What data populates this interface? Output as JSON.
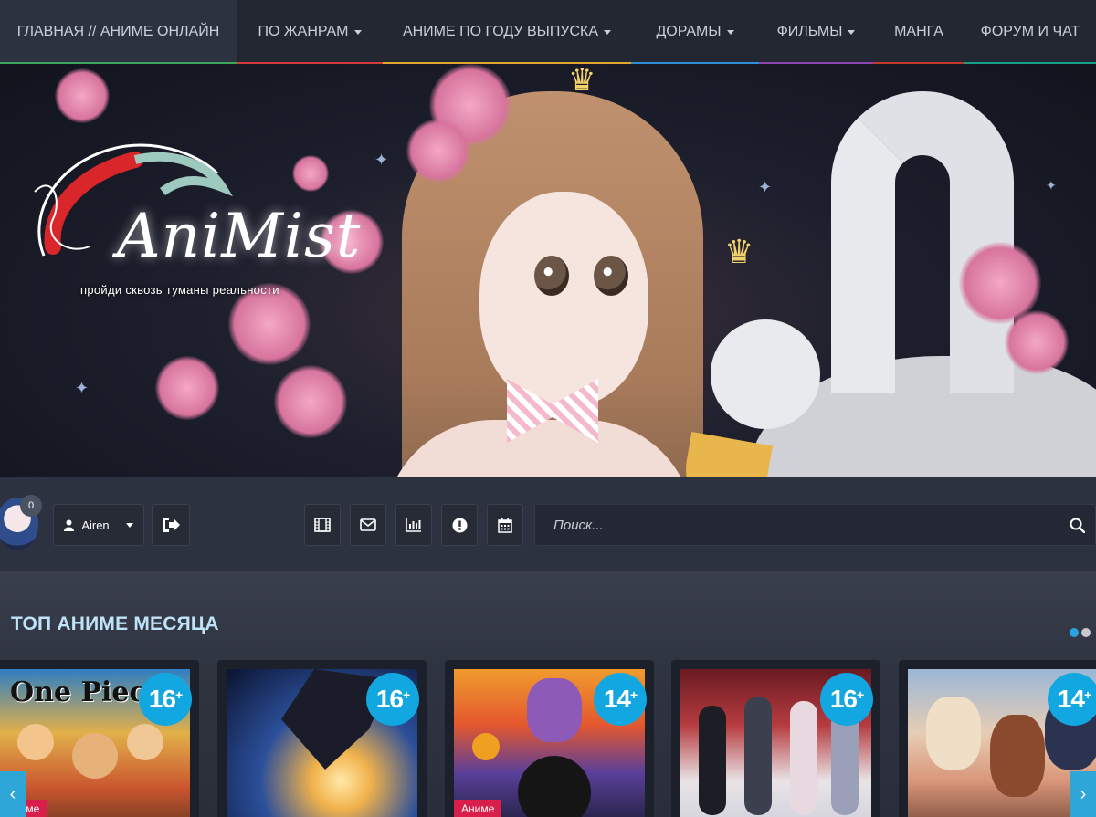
{
  "nav": {
    "items": [
      {
        "label": "ГЛАВНАЯ // АНИМЕ ОНЛАЙН",
        "dropdown": false,
        "active": true,
        "bar_color": "#3ba55c"
      },
      {
        "label": "ПО ЖАНРАМ",
        "dropdown": true,
        "active": false,
        "bar_color": "#d43b3b"
      },
      {
        "label": "АНИМЕ ПО ГОДУ ВЫПУСКА",
        "dropdown": true,
        "active": false,
        "bar_color": "#e0a72a"
      },
      {
        "label": "ДОРАМЫ",
        "dropdown": true,
        "active": false,
        "bar_color": "#2f8fd6"
      },
      {
        "label": "ФИЛЬМЫ",
        "dropdown": true,
        "active": false,
        "bar_color": "#8e44ad"
      },
      {
        "label": "МАНГА",
        "dropdown": false,
        "active": false,
        "bar_color": "#c0392b"
      },
      {
        "label": "ФОРУМ И ЧАТ",
        "dropdown": false,
        "active": false,
        "bar_color": "#16a085"
      }
    ]
  },
  "banner": {
    "logo_title": "AniMist",
    "logo_tagline": "пройди сквозь туманы реальности"
  },
  "toolbar": {
    "notification_count": "0",
    "username": "Airen",
    "icons": [
      "film-icon",
      "envelope-icon",
      "bar-chart-icon",
      "alert-icon",
      "calendar-icon"
    ],
    "search_placeholder": "Поиск..."
  },
  "top_section": {
    "title": "ТОП АНИМЕ МЕСЯЦА",
    "cards": [
      {
        "age": "16",
        "tag": "Аниме",
        "art": "One Piece"
      },
      {
        "age": "16",
        "tag": "",
        "art": ""
      },
      {
        "age": "14",
        "tag": "Аниме",
        "art": ""
      },
      {
        "age": "16",
        "tag": "",
        "art": ""
      },
      {
        "age": "14",
        "tag": "",
        "art": ""
      }
    ]
  },
  "colors": {
    "accent": "#13a7e1",
    "tag": "#d81f4b",
    "nav_bg": "#222732"
  }
}
